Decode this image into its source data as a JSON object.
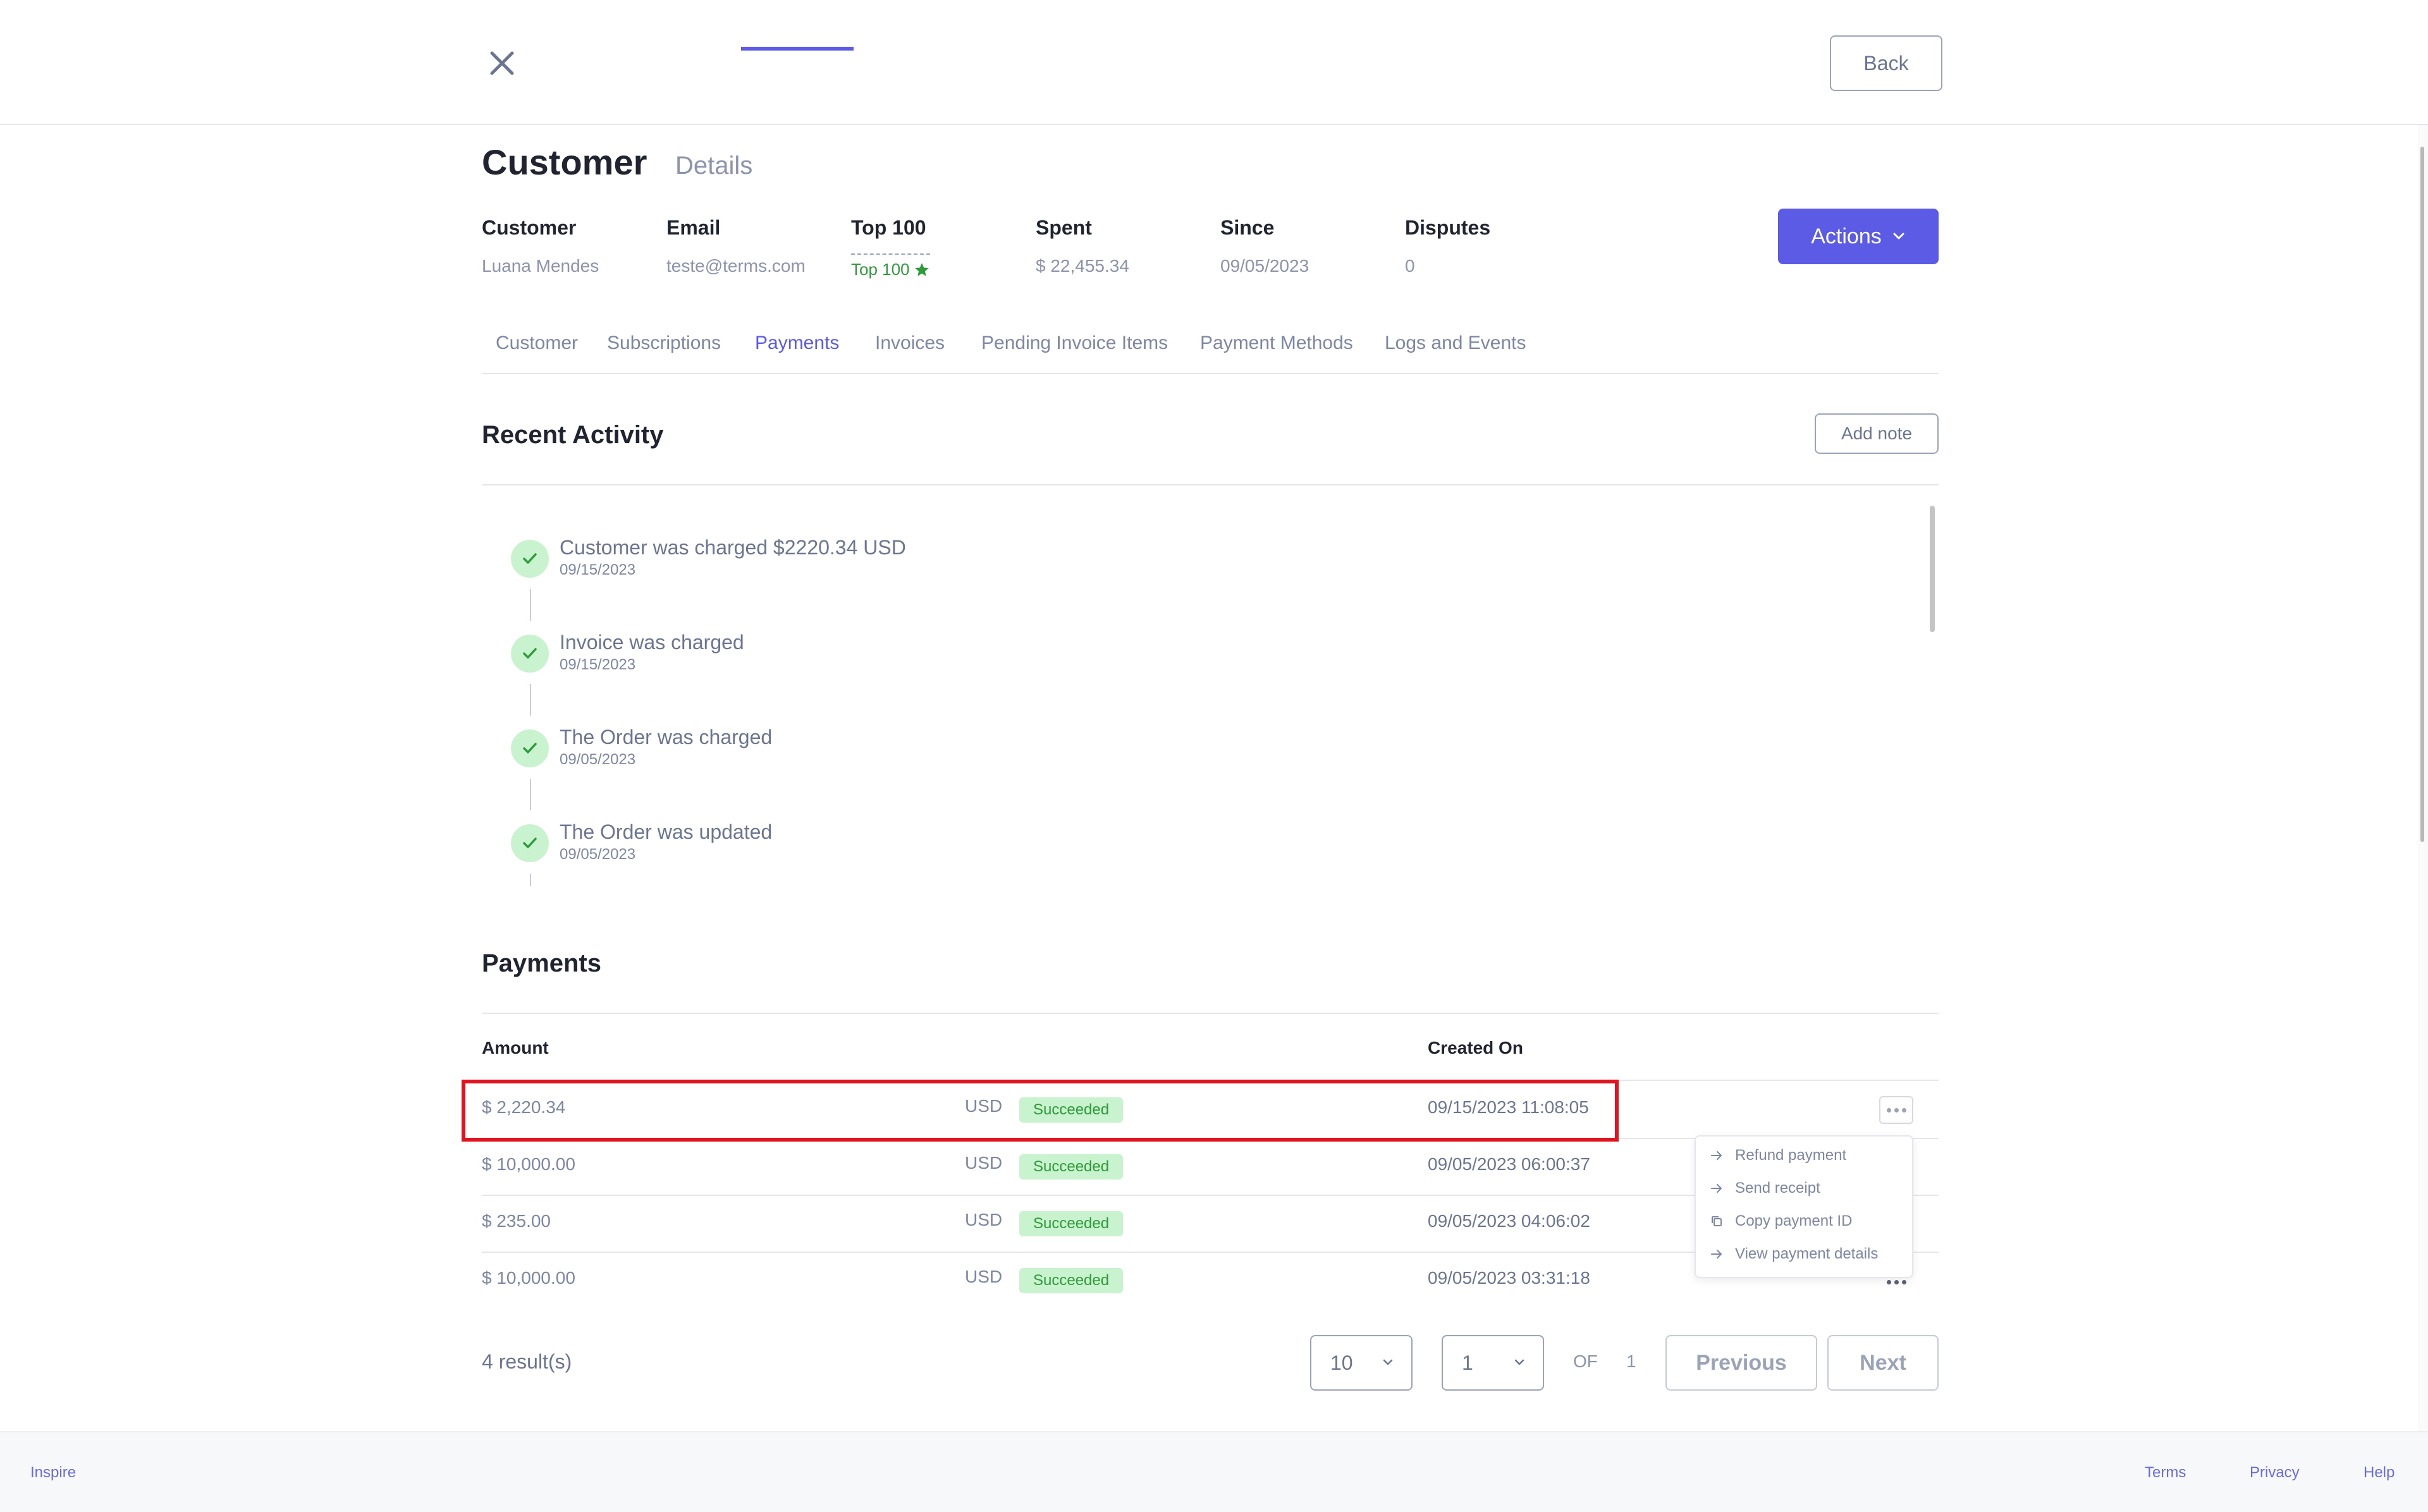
{
  "header": {
    "back_label": "Back"
  },
  "customer": {
    "title": "Customer",
    "subtitle": "Details",
    "summary": [
      {
        "label": "Customer",
        "value": "Luana Mendes"
      },
      {
        "label": "Email",
        "value": "teste@terms.com"
      },
      {
        "label": "Top 100",
        "badge": "Top 100"
      },
      {
        "label": "Spent",
        "value": "$ 22,455.34"
      },
      {
        "label": "Since",
        "value": "09/05/2023"
      },
      {
        "label": "Disputes",
        "value": "0"
      }
    ],
    "actions_label": "Actions"
  },
  "tabs": [
    {
      "label": "Customer"
    },
    {
      "label": "Subscriptions"
    },
    {
      "label": "Payments",
      "active": true
    },
    {
      "label": "Invoices"
    },
    {
      "label": "Pending Invoice Items"
    },
    {
      "label": "Payment Methods"
    },
    {
      "label": "Logs and Events"
    }
  ],
  "recent_activity": {
    "title": "Recent Activity",
    "add_note_label": "Add note",
    "items": [
      {
        "text": "Customer was charged $2220.34 USD",
        "date": "09/15/2023"
      },
      {
        "text": "Invoice was charged",
        "date": "09/15/2023"
      },
      {
        "text": "The Order was charged",
        "date": "09/05/2023"
      },
      {
        "text": "The Order was updated",
        "date": "09/05/2023"
      }
    ]
  },
  "payments": {
    "title": "Payments",
    "columns": {
      "amount": "Amount",
      "created_on": "Created On"
    },
    "rows": [
      {
        "amount": "$ 2,220.34",
        "currency": "USD",
        "status": "Succeeded",
        "created_on": "09/15/2023 11:08:05"
      },
      {
        "amount": "$ 10,000.00",
        "currency": "USD",
        "status": "Succeeded",
        "created_on": "09/05/2023 06:00:37"
      },
      {
        "amount": "$ 235.00",
        "currency": "USD",
        "status": "Succeeded",
        "created_on": "09/05/2023 04:06:02"
      },
      {
        "amount": "$ 10,000.00",
        "currency": "USD",
        "status": "Succeeded",
        "created_on": "09/05/2023 03:31:18"
      }
    ],
    "row_menu": [
      {
        "label": "Refund payment",
        "icon": "arrow-right-icon"
      },
      {
        "label": "Send receipt",
        "icon": "arrow-right-icon"
      },
      {
        "label": "Copy payment ID",
        "icon": "copy-icon"
      },
      {
        "label": "View payment details",
        "icon": "arrow-right-icon"
      }
    ]
  },
  "pagination": {
    "results": "4 result(s)",
    "page_size": "10",
    "page": "1",
    "of_label": "OF",
    "total_pages": "1",
    "previous_label": "Previous",
    "next_label": "Next"
  },
  "footer": {
    "brand": "Inspire",
    "links": [
      "Terms",
      "Privacy",
      "Help"
    ]
  },
  "colors": {
    "accent": "#5b5be6",
    "success_bg": "#c9f2cf",
    "success_text": "#2e9b3a",
    "highlight": "#e0141e"
  }
}
